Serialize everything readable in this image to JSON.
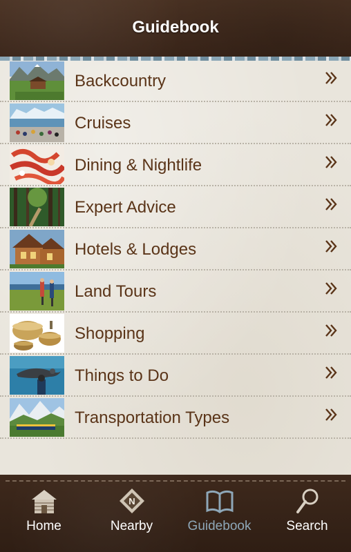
{
  "header": {
    "title": "Guidebook"
  },
  "items": [
    {
      "label": "Backcountry",
      "icon": "backcountry-cabin-image"
    },
    {
      "label": "Cruises",
      "icon": "cruise-glacier-image"
    },
    {
      "label": "Dining & Nightlife",
      "icon": "crab-dinner-image"
    },
    {
      "label": "Expert Advice",
      "icon": "forest-trail-image"
    },
    {
      "label": "Hotels & Lodges",
      "icon": "log-lodge-image"
    },
    {
      "label": "Land Tours",
      "icon": "hikers-lake-image"
    },
    {
      "label": "Shopping",
      "icon": "wooden-bowls-image"
    },
    {
      "label": "Things to Do",
      "icon": "sea-lion-aquarium-image"
    },
    {
      "label": "Transportation Types",
      "icon": "train-mountains-image"
    }
  ],
  "tabs": [
    {
      "label": "Home",
      "icon": "cabin-icon",
      "active": false
    },
    {
      "label": "Nearby",
      "icon": "compass-n-icon",
      "active": false
    },
    {
      "label": "Guidebook",
      "icon": "open-book-icon",
      "active": true
    },
    {
      "label": "Search",
      "icon": "magnifier-icon",
      "active": false
    }
  ],
  "colors": {
    "header_bg": "#3f2a1d",
    "item_text": "#5a3418",
    "active_tab": "#8ea7b8"
  }
}
